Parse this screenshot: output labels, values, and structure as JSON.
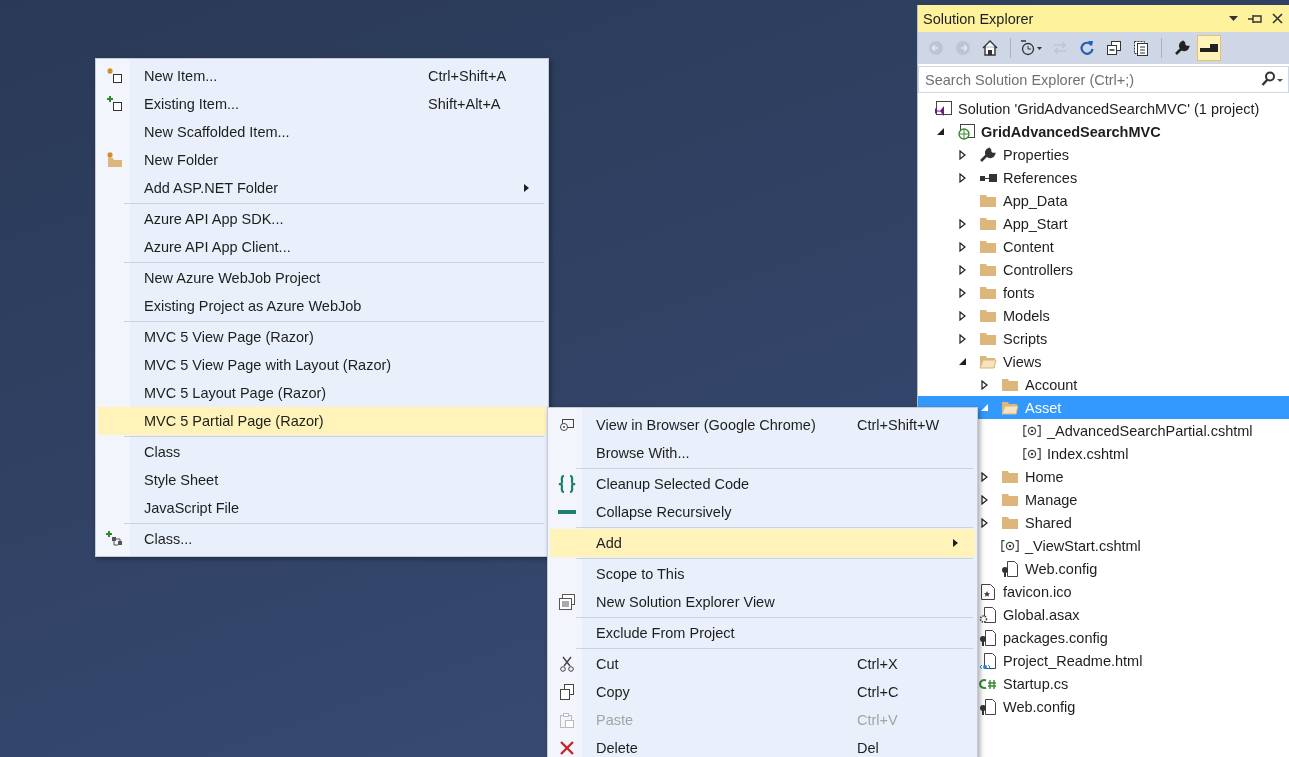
{
  "context_menu": {
    "items": [
      {
        "kind": "item",
        "label": "New Item...",
        "shortcut": "Ctrl+Shift+A",
        "submenu": false,
        "selected": false,
        "disabled": false
      },
      {
        "kind": "item",
        "label": "Existing Item...",
        "shortcut": "Shift+Alt+A",
        "submenu": false,
        "selected": false,
        "disabled": false
      },
      {
        "kind": "item",
        "label": "New Scaffolded Item...",
        "submenu": false,
        "selected": false,
        "disabled": false
      },
      {
        "kind": "item",
        "label": "New Folder",
        "submenu": false,
        "selected": false,
        "disabled": false
      },
      {
        "kind": "item",
        "label": "Add ASP.NET Folder",
        "submenu": true,
        "selected": false,
        "disabled": false
      },
      {
        "kind": "separator"
      },
      {
        "kind": "item",
        "label": "Azure API App SDK...",
        "submenu": false,
        "selected": false,
        "disabled": false
      },
      {
        "kind": "item",
        "label": "Azure API App Client...",
        "submenu": false,
        "selected": false,
        "disabled": false
      },
      {
        "kind": "separator"
      },
      {
        "kind": "item",
        "label": "New Azure WebJob Project",
        "submenu": false,
        "selected": false,
        "disabled": false
      },
      {
        "kind": "item",
        "label": "Existing Project as Azure WebJob",
        "submenu": false,
        "selected": false,
        "disabled": false
      },
      {
        "kind": "separator"
      },
      {
        "kind": "item",
        "label": "MVC 5 View Page (Razor)",
        "submenu": false,
        "selected": false,
        "disabled": false
      },
      {
        "kind": "item",
        "label": "MVC 5 View Page with Layout (Razor)",
        "submenu": false,
        "selected": false,
        "disabled": false
      },
      {
        "kind": "item",
        "label": "MVC 5 Layout Page (Razor)",
        "submenu": false,
        "selected": false,
        "disabled": false
      },
      {
        "kind": "item",
        "label": "MVC 5 Partial Page (Razor)",
        "submenu": false,
        "selected": true,
        "disabled": false
      },
      {
        "kind": "separator"
      },
      {
        "kind": "item",
        "label": "Class",
        "submenu": false,
        "selected": false,
        "disabled": false
      },
      {
        "kind": "item",
        "label": "Style Sheet",
        "submenu": false,
        "selected": false,
        "disabled": false
      },
      {
        "kind": "item",
        "label": "JavaScript File",
        "submenu": false,
        "selected": false,
        "disabled": false
      },
      {
        "kind": "separator"
      },
      {
        "kind": "item",
        "label": "Class...",
        "submenu": false,
        "selected": false,
        "disabled": false
      }
    ]
  },
  "folder_menu": {
    "items": [
      {
        "kind": "item",
        "label": "View in Browser (Google Chrome)",
        "shortcut": "Ctrl+Shift+W",
        "submenu": false,
        "selected": false,
        "disabled": false
      },
      {
        "kind": "item",
        "label": "Browse With...",
        "submenu": false,
        "selected": false,
        "disabled": false
      },
      {
        "kind": "separator"
      },
      {
        "kind": "item",
        "label": "Cleanup Selected Code",
        "submenu": false,
        "selected": false,
        "disabled": false
      },
      {
        "kind": "item",
        "label": "Collapse Recursively",
        "submenu": false,
        "selected": false,
        "disabled": false
      },
      {
        "kind": "separator"
      },
      {
        "kind": "item",
        "label": "Add",
        "submenu": true,
        "selected": true,
        "disabled": false
      },
      {
        "kind": "separator"
      },
      {
        "kind": "item",
        "label": "Scope to This",
        "submenu": false,
        "selected": false,
        "disabled": false
      },
      {
        "kind": "item",
        "label": "New Solution Explorer View",
        "submenu": false,
        "selected": false,
        "disabled": false
      },
      {
        "kind": "separator"
      },
      {
        "kind": "item",
        "label": "Exclude From Project",
        "submenu": false,
        "selected": false,
        "disabled": false
      },
      {
        "kind": "separator"
      },
      {
        "kind": "item",
        "label": "Cut",
        "shortcut": "Ctrl+X",
        "submenu": false,
        "selected": false,
        "disabled": false
      },
      {
        "kind": "item",
        "label": "Copy",
        "shortcut": "Ctrl+C",
        "submenu": false,
        "selected": false,
        "disabled": false
      },
      {
        "kind": "item",
        "label": "Paste",
        "shortcut": "Ctrl+V",
        "submenu": false,
        "selected": false,
        "disabled": true
      },
      {
        "kind": "item",
        "label": "Delete",
        "shortcut": "Del",
        "submenu": false,
        "selected": false,
        "disabled": false
      }
    ]
  },
  "solution_explorer": {
    "title": "Solution Explorer",
    "toolbar": [
      {
        "kind": "back",
        "disabled": true,
        "selected": false
      },
      {
        "kind": "forward",
        "disabled": true,
        "selected": false
      },
      {
        "kind": "home",
        "disabled": false,
        "selected": false
      },
      {
        "kind": "separator"
      },
      {
        "kind": "pending-changes",
        "disabled": false,
        "selected": false
      },
      {
        "kind": "sync",
        "disabled": true,
        "selected": false
      },
      {
        "kind": "refresh",
        "disabled": false,
        "selected": false
      },
      {
        "kind": "collapse-all",
        "disabled": false,
        "selected": false
      },
      {
        "kind": "show-all-files",
        "disabled": false,
        "selected": false
      },
      {
        "kind": "separator"
      },
      {
        "kind": "properties",
        "disabled": false,
        "selected": false
      },
      {
        "kind": "preview",
        "disabled": false,
        "selected": true
      }
    ],
    "search": {
      "placeholder": "Search Solution Explorer (Ctrl+;)"
    },
    "tree": [
      {
        "label": "Solution 'GridAdvancedSearchMVC' (1 project)",
        "kind": "solution",
        "selected": false,
        "children": [
          {
            "label": "GridAdvancedSearchMVC",
            "kind": "project",
            "selected": false,
            "expanded": true,
            "children": [
              {
                "label": "Properties",
                "kind": "properties",
                "selected": false,
                "expanded": false
              },
              {
                "label": "References",
                "kind": "references",
                "selected": false,
                "expanded": false
              },
              {
                "label": "App_Data",
                "kind": "folder",
                "selected": false
              },
              {
                "label": "App_Start",
                "kind": "folder",
                "selected": false,
                "expanded": false
              },
              {
                "label": "Content",
                "kind": "folder",
                "selected": false,
                "expanded": false
              },
              {
                "label": "Controllers",
                "kind": "folder",
                "selected": false,
                "expanded": false
              },
              {
                "label": "fonts",
                "kind": "folder",
                "selected": false,
                "expanded": false
              },
              {
                "label": "Models",
                "kind": "folder",
                "selected": false,
                "expanded": false
              },
              {
                "label": "Scripts",
                "kind": "folder",
                "selected": false,
                "expanded": false
              },
              {
                "label": "Views",
                "kind": "folder",
                "selected": false,
                "expanded": true,
                "children": [
                  {
                    "label": "Account",
                    "kind": "folder",
                    "selected": false,
                    "expanded": false
                  },
                  {
                    "label": "Asset",
                    "kind": "folder",
                    "selected": true,
                    "expanded": true,
                    "children": [
                      {
                        "label": "_AdvancedSearchPartial.cshtml",
                        "kind": "razor",
                        "selected": false
                      },
                      {
                        "label": "Index.cshtml",
                        "kind": "razor",
                        "selected": false
                      }
                    ]
                  },
                  {
                    "label": "Home",
                    "kind": "folder",
                    "selected": false,
                    "expanded": false
                  },
                  {
                    "label": "Manage",
                    "kind": "folder",
                    "selected": false,
                    "expanded": false
                  },
                  {
                    "label": "Shared",
                    "kind": "folder",
                    "selected": false,
                    "expanded": false
                  },
                  {
                    "label": "_ViewStart.cshtml",
                    "kind": "razor",
                    "selected": false
                  },
                  {
                    "label": "Web.config",
                    "kind": "config",
                    "selected": false
                  }
                ]
              },
              {
                "label": "favicon.ico",
                "kind": "image",
                "selected": false
              },
              {
                "label": "Global.asax",
                "kind": "asax",
                "selected": false
              },
              {
                "label": "packages.config",
                "kind": "config",
                "selected": false
              },
              {
                "label": "Project_Readme.html",
                "kind": "html",
                "selected": false
              },
              {
                "label": "Startup.cs",
                "kind": "csharp",
                "selected": false
              },
              {
                "label": "Web.config",
                "kind": "config",
                "selected": false
              }
            ]
          }
        ]
      }
    ]
  }
}
